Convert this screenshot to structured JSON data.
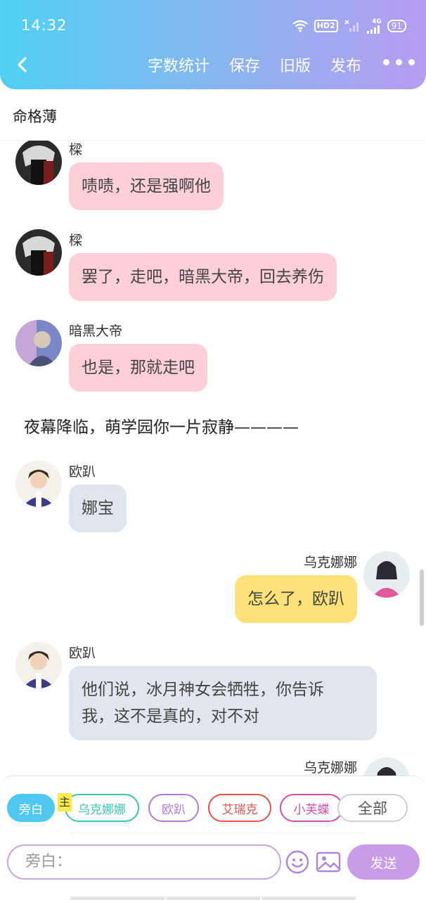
{
  "status_bar": {
    "time": "14:32",
    "hd_label": "HD2",
    "network_label": "4G",
    "battery": "91"
  },
  "nav": {
    "back_icon": "chevron-left-icon",
    "actions": [
      "字数统计",
      "保存",
      "旧版",
      "发布"
    ],
    "more_icon": "more-dots-icon"
  },
  "page_title": "命格薄",
  "messages": [
    {
      "type": "left",
      "name": "樑",
      "text": "啧啧，还是强啊他",
      "bubble": "pink"
    },
    {
      "type": "left",
      "name": "樑",
      "text": "罢了，走吧，暗黑大帝，回去养伤",
      "bubble": "pink"
    },
    {
      "type": "left",
      "name": "暗黑大帝",
      "text": "也是，那就走吧",
      "bubble": "pink"
    },
    {
      "type": "narration",
      "text": "夜幕降临，萌学园你一片寂静————"
    },
    {
      "type": "left",
      "name": "欧趴",
      "text": "娜宝",
      "bubble": "gray"
    },
    {
      "type": "right",
      "name": "乌克娜娜",
      "text": "怎么了，欧趴",
      "bubble": "yellow"
    },
    {
      "type": "left",
      "name": "欧趴",
      "text_line1": "他们说，冰月神女会牺牲，你告诉",
      "text_line2": "我，这不是真的，对不对",
      "bubble": "gray"
    },
    {
      "type": "right",
      "name": "乌克娜娜"
    }
  ],
  "roles": {
    "host_tag": "主",
    "items": [
      {
        "label": "旁白",
        "color": "#4fc7ef",
        "active": true
      },
      {
        "label": "乌克娜娜",
        "color": "#3cc4b4"
      },
      {
        "label": "欧趴",
        "color": "#b57ad6"
      },
      {
        "label": "艾瑞克",
        "color": "#e0524c"
      },
      {
        "label": "小芙蝶",
        "color": "#d34fa9"
      },
      {
        "label": "全部",
        "color": "#bbbbbb"
      }
    ]
  },
  "composer": {
    "placeholder": "旁白：",
    "emoji_icon": "emoji-icon",
    "image_icon": "image-icon",
    "send_label": "发送"
  }
}
